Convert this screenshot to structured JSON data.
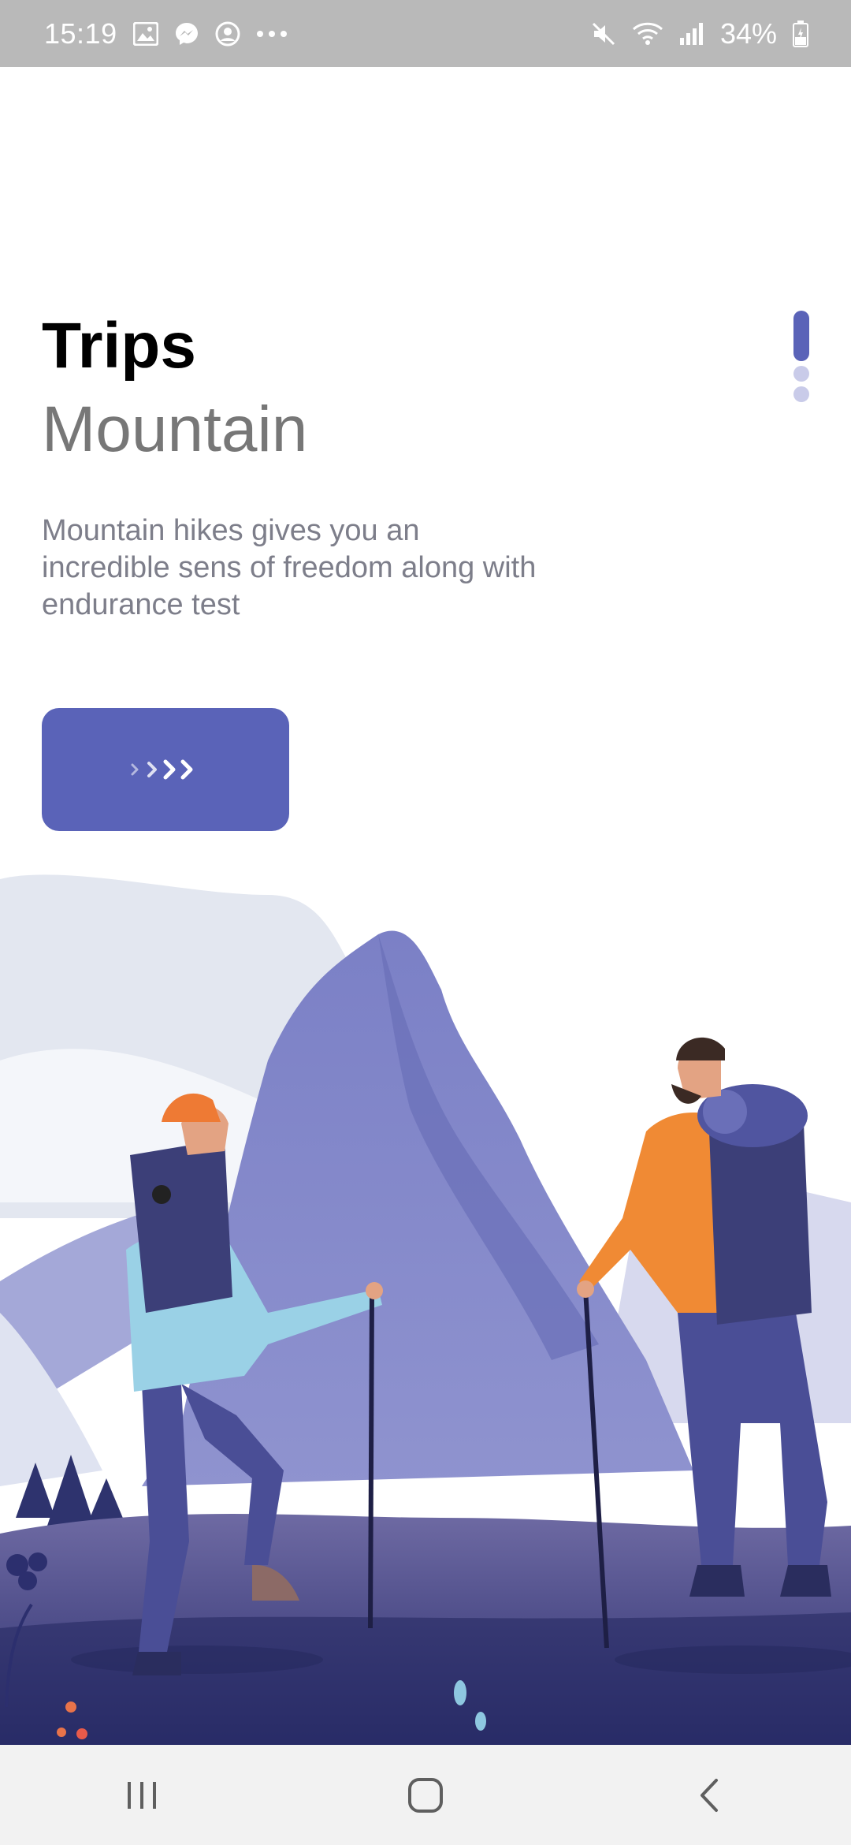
{
  "status_bar": {
    "time": "15:19",
    "battery": "34%",
    "left_icons": [
      "image-icon",
      "messenger-icon",
      "account-icon",
      "more-dots-icon"
    ],
    "right_icons": [
      "mute-icon",
      "wifi-icon",
      "signal-icon",
      "battery-icon"
    ]
  },
  "onboarding": {
    "title": "Trips",
    "subtitle": "Mountain",
    "description": "Mountain hikes gives you an incredible sens of freedom along with endurance test",
    "next_button": {
      "label": ">>>",
      "icon": "chevrons-right-icon"
    },
    "pager": {
      "pages": 3,
      "active_page": 1
    }
  },
  "illustration": {
    "name": "hikers-mountain-illustration"
  },
  "nav_bar": {
    "items": [
      "recent-apps-icon",
      "home-icon",
      "back-icon"
    ]
  },
  "colors": {
    "accent": "#5a63b8",
    "accent_light": "#c9cbe9",
    "title": "#000000",
    "subtitle": "#777777",
    "body_text": "#7d7e8a",
    "status_bar_bg": "#b9b9b9",
    "nav_bar_bg": "#f2f2f2"
  }
}
